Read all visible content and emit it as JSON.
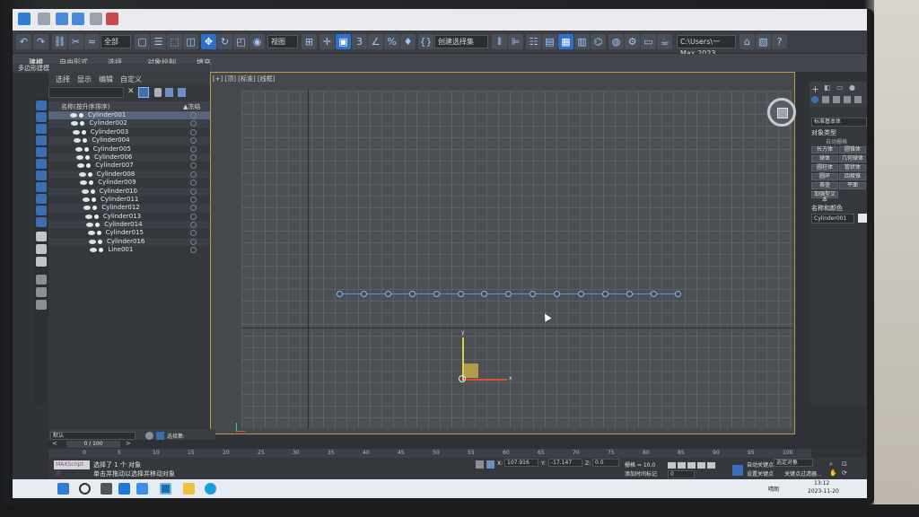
{
  "toolbar": {
    "selection_filter": "全部",
    "view_dropdown": "视图",
    "named_selection": "创建选择集",
    "path_field": "C:\\Users\\一 Max 2023"
  },
  "ribbon": {
    "tabs": [
      "建模",
      "自由形式",
      "选择",
      "对象绘制",
      "填充"
    ],
    "sub_label": "多边形建模"
  },
  "scene_explorer": {
    "menu": [
      "选择",
      "显示",
      "编辑",
      "自定义"
    ],
    "header_name": "名称(按升序排序)",
    "header_frozen": "▲冻结",
    "items": [
      "Cylinder001",
      "Cylinder002",
      "Cylinder003",
      "Cylinder004",
      "Cylinder005",
      "Cylinder006",
      "Cylinder007",
      "Cylinder008",
      "Cylinder009",
      "Cylinder010",
      "Cylinder011",
      "Cylinder012",
      "Cylinder013",
      "Cylinder014",
      "Cylinder015",
      "Cylinder016",
      "Line001"
    ],
    "layer_label": "默认",
    "selection_set_label": "选择集:"
  },
  "viewport": {
    "label": "[+] [顶] [标准] [线框]",
    "gizmo_y": "y",
    "gizmo_x": "x"
  },
  "command_panel": {
    "category": "标准基本体",
    "rollout_object_type": "对象类型",
    "autogrid": "自动栅格",
    "buttons": [
      "长方体",
      "圆锥体",
      "球体",
      "几何球体",
      "圆柱体",
      "管状体",
      "圆环",
      "四棱锥",
      "茶壶",
      "平面",
      "加强型文本"
    ],
    "rollout_name_color": "名称和颜色",
    "object_name": "Cylinder001"
  },
  "timeline": {
    "frame_display": "0 / 100",
    "ticks": [
      "0",
      "5",
      "10",
      "15",
      "20",
      "25",
      "30",
      "35",
      "40",
      "45",
      "50",
      "55",
      "60",
      "65",
      "70",
      "75",
      "80",
      "85",
      "90",
      "95",
      "100"
    ]
  },
  "status": {
    "maxscript": "MAXScript 迷",
    "line1": "选择了 1 个 对象",
    "line2": "单击并拖动以选择并移动对象",
    "x_label": "X:",
    "x_value": "107.916",
    "y_label": "Y:",
    "y_value": "-17.147",
    "z_label": "Z:",
    "z_value": "0.0",
    "grid": "栅格 = 10.0",
    "add_time_tag": "添加时间标记",
    "auto_key": "自动关键点",
    "set_key": "设置关键点",
    "selected_object": "选定对象",
    "key_filters": "关键点过滤器...",
    "frame": "0"
  },
  "taskbar": {
    "weather": "晴朗",
    "time": "13:12",
    "date": "2023-11-20"
  },
  "colors": {
    "accent": "#3d6fb0",
    "selection_border": "#b99a4f",
    "spline": "#5e8edc"
  }
}
